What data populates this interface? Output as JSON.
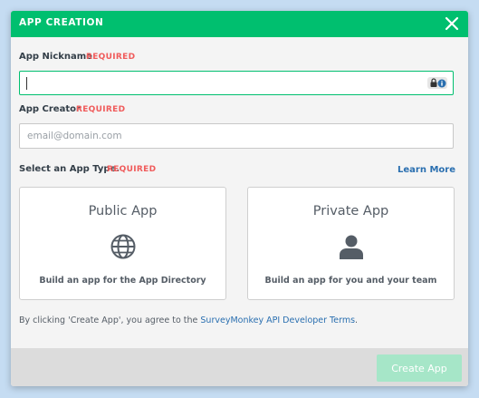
{
  "modal": {
    "title": "APP CREATION",
    "close_icon": "close-icon"
  },
  "nickname": {
    "label": "App Nickname",
    "required": "REQUIRED",
    "value": ""
  },
  "creator": {
    "label": "App Creator",
    "required": "REQUIRED",
    "placeholder": "email@domain.com"
  },
  "app_type": {
    "label": "Select an App Type.",
    "required": "REQUIRED",
    "learn_more": "Learn More",
    "options": [
      {
        "title": "Public App",
        "icon": "globe-icon",
        "description": "Build an app for the App Directory"
      },
      {
        "title": "Private App",
        "icon": "person-icon",
        "description": "Build an app for you and your team"
      }
    ]
  },
  "terms": {
    "prefix": "By clicking 'Create App', you agree to the ",
    "link": "SurveyMonkey API Developer Terms",
    "suffix": "."
  },
  "footer": {
    "create_label": "Create App"
  },
  "colors": {
    "header": "#00bf6f",
    "required": "#f05b5b",
    "link": "#2a6fb0",
    "button_disabled": "#a6e6c8"
  }
}
